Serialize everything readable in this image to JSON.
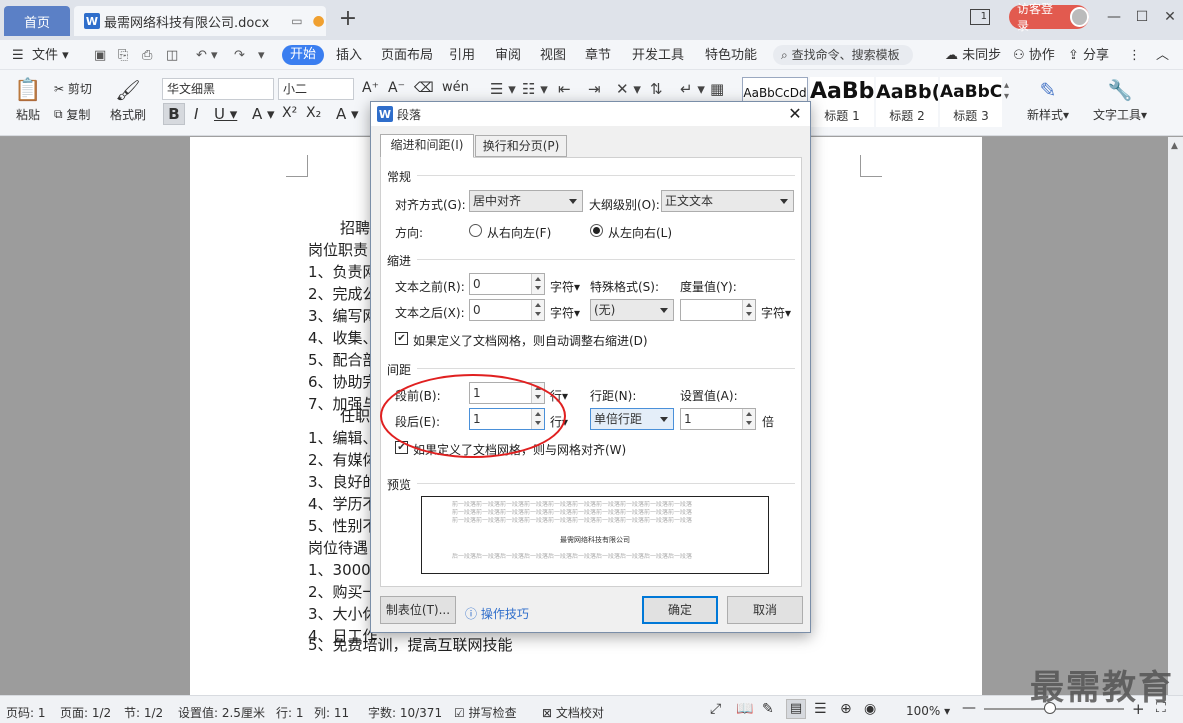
{
  "titlebar": {
    "home_tab": "首页",
    "doc_tab": "最需网络科技有限公司.docx",
    "new_tab": "+",
    "login": "访客登录",
    "win_min": "—",
    "win_max": "☐",
    "win_close": "✕",
    "page_num": "1"
  },
  "menu": {
    "file": "文件",
    "start": "开始",
    "items": [
      "插入",
      "页面布局",
      "引用",
      "审阅",
      "视图",
      "章节",
      "开发工具",
      "特色功能"
    ],
    "search": "查找命令、搜索模板",
    "sync": "未同步",
    "collab": "协作",
    "share": "分享"
  },
  "ribbon": {
    "paste": "粘贴",
    "cut": "剪切",
    "copy": "复制",
    "format_painter": "格式刷",
    "font_name": "华文细黑",
    "font_size": "小二",
    "styles": [
      {
        "preview": "AaBbCcDd",
        "label": ""
      },
      {
        "preview": "AaBb",
        "label": "标题 1"
      },
      {
        "preview": "AaBb(",
        "label": "标题 2"
      },
      {
        "preview": "AaBbC",
        "label": "标题 3"
      }
    ],
    "new_style": "新样式",
    "text_tools": "文字工具"
  },
  "document": {
    "lines": [
      "招聘",
      "岗位职责",
      "1、负责网",
      "2、完成公",
      "3、编写网",
      "4、收集、",
      "5、配合部",
      "6、协助完",
      "7、加强与",
      "任职",
      "1、编辑、",
      "2、有媒体",
      "3、良好的",
      "4、学历不",
      "5、性别不",
      "岗位待遇",
      "1、3000",
      "2、购买一",
      "3、大小休",
      "4、日工作",
      "5、免费培训，提高互联网技能"
    ]
  },
  "dialog": {
    "title": "段落",
    "tabs": [
      "缩进和间距(I)",
      "换行和分页(P)"
    ],
    "general": {
      "heading": "常规",
      "align_label": "对齐方式(G):",
      "align_value": "居中对齐",
      "outline_label": "大纲级别(O):",
      "outline_value": "正文文本",
      "direction_label": "方向:",
      "rtl": "从右向左(F)",
      "ltr": "从左向右(L)"
    },
    "indent": {
      "heading": "缩进",
      "before_label": "文本之前(R):",
      "before_value": "0",
      "before_unit": "字符",
      "after_label": "文本之后(X):",
      "after_value": "0",
      "after_unit": "字符",
      "special_label": "特殊格式(S):",
      "special_value": "(无)",
      "measure_label": "度量值(Y):",
      "measure_value": "",
      "measure_unit": "字符",
      "grid_check": "如果定义了文档网格，则自动调整右缩进(D)"
    },
    "spacing": {
      "heading": "间距",
      "before_label": "段前(B):",
      "before_value": "1",
      "before_unit": "行",
      "after_label": "段后(E):",
      "after_value": "1",
      "after_unit": "行",
      "line_label": "行距(N):",
      "line_value": "单倍行距",
      "set_label": "设置值(A):",
      "set_value": "1",
      "set_unit": "倍",
      "grid_check": "如果定义了文档网格，则与网格对齐(W)"
    },
    "preview": {
      "heading": "预览",
      "filler": "前一段落前一段落前一段落前一段落前一段落前一段落前一段落前一段落前一段落前一段落",
      "sample": "最需网络科技有限公司",
      "after_filler": "后一段落后一段落后一段落后一段落后一段落后一段落后一段落后一段落后一段落后一段落"
    },
    "tabs_btn": "制表位(T)...",
    "tips": "操作技巧",
    "ok": "确定",
    "cancel": "取消"
  },
  "status": {
    "page_code": "页码: 1",
    "page": "页面: 1/2",
    "section": "节: 1/2",
    "setting": "设置值: 2.5厘米",
    "row": "行: 1",
    "col": "列: 11",
    "words": "字数: 10/371",
    "spell": "拼写检查",
    "proof": "文档校对",
    "zoom": "100%"
  },
  "watermark": "最需教育",
  "colors": {
    "accent": "#3a7ef0",
    "home_tab": "#5b80c6",
    "login": "#e25a4f",
    "circle": "#e02020"
  }
}
